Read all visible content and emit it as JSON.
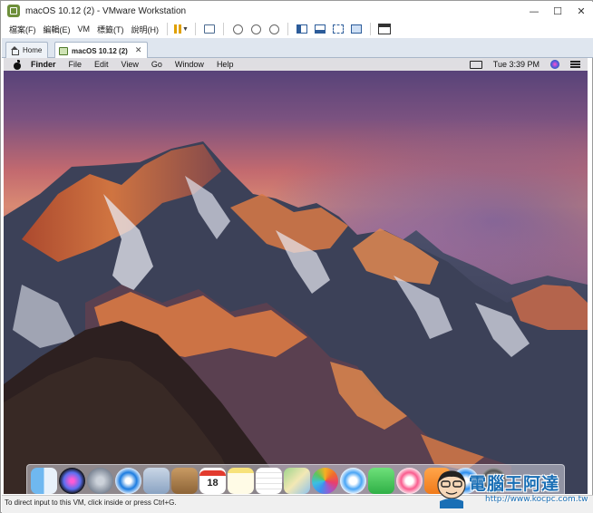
{
  "window": {
    "title": "macOS 10.12 (2) - VMware Workstation",
    "controls": {
      "minimize": "—",
      "maximize": "☐",
      "close": "✕"
    }
  },
  "menubar": {
    "items": [
      "檔案(F)",
      "編輯(E)",
      "VM",
      "標籤(T)",
      "說明(H)"
    ]
  },
  "toolbar": {
    "icons": [
      "pause-icon",
      "send-ctrl-alt-del-icon",
      "snapshot-icon",
      "revert-snapshot-icon",
      "snapshot-manager-icon",
      "sidebar-icon",
      "thumbnail-icon",
      "fullscreen-icon",
      "unity-icon",
      "console-view-icon"
    ]
  },
  "tabs": [
    {
      "label": "Home",
      "icon": "home-icon",
      "active": false
    },
    {
      "label": "macOS 10.12 (2)",
      "icon": "vm-icon",
      "active": true,
      "close": "✕"
    }
  ],
  "guest": {
    "menubar": {
      "app": "Finder",
      "items": [
        "File",
        "Edit",
        "View",
        "Go",
        "Window",
        "Help"
      ],
      "clock": "Tue 3:39 PM"
    },
    "dock": {
      "apps": [
        "Finder",
        "Siri",
        "Launchpad",
        "Safari",
        "Mail",
        "Contacts",
        "Calendar",
        "Notes",
        "Reminders",
        "Maps",
        "Photos",
        "Messages",
        "FaceTime",
        "iTunes",
        "iBooks",
        "App Store",
        "System Preferences"
      ],
      "calendar_day": "18"
    }
  },
  "statusbar": {
    "text": "To direct input to this VM, click inside or press Ctrl+G."
  },
  "watermark": {
    "title": "電腦王阿達",
    "url": "http://www.kocpc.com.tw"
  }
}
